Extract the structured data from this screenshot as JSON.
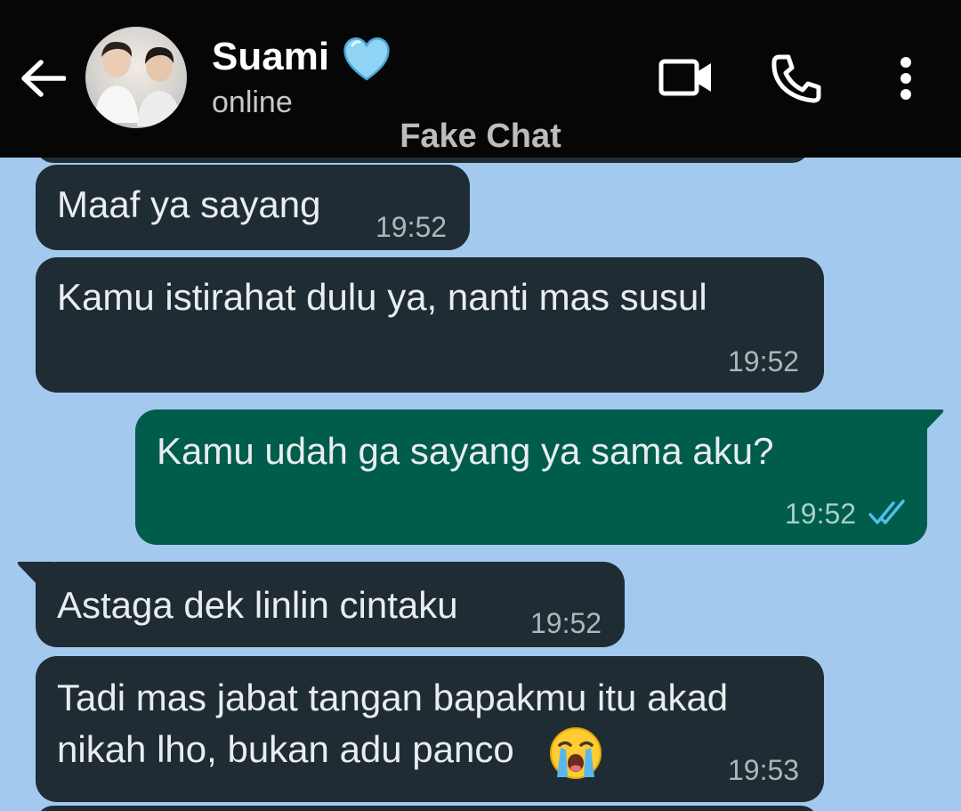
{
  "header": {
    "contact_name": "Suami",
    "status": "online",
    "watermark": "Fake Chat",
    "background_color": "#060606"
  },
  "chat": {
    "background_color": "#a4c9ef",
    "incoming_bubble_color": "#202c33",
    "outgoing_bubble_color": "#005c4b",
    "messages": [
      {
        "direction": "in",
        "text": "Maaf ya sayang",
        "time": "19:52"
      },
      {
        "direction": "in",
        "text": "Kamu istirahat dulu ya, nanti mas susul",
        "time": "19:52"
      },
      {
        "direction": "out",
        "text": "Kamu udah ga sayang ya sama aku?",
        "time": "19:52",
        "status": "read"
      },
      {
        "direction": "in",
        "text": "Astaga dek linlin cintaku",
        "time": "19:52"
      },
      {
        "direction": "in",
        "text_line1": "Tadi mas jabat tangan bapakmu itu akad",
        "text_line2": "nikah lho, bukan adu panco",
        "emoji": "loudly-crying-face",
        "time": "19:53"
      }
    ]
  },
  "icons": {
    "back": "arrow-left-icon",
    "verified": "light-blue-heart-icon",
    "video": "video-camera-icon",
    "call": "phone-icon",
    "menu": "more-vertical-icon",
    "read_receipt": "double-check-icon"
  }
}
